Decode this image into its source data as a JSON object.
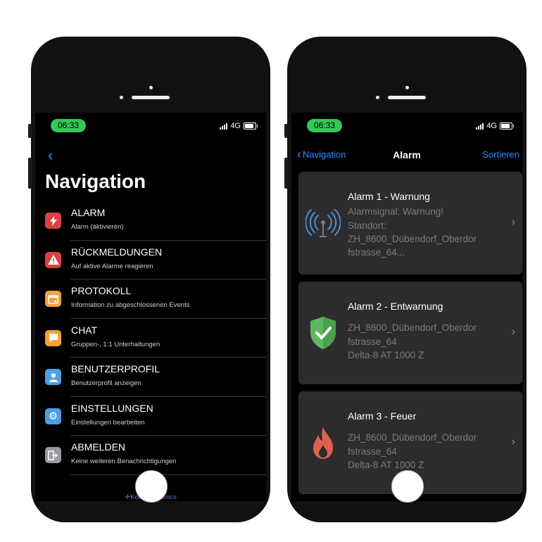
{
  "left_phone": {
    "status": {
      "time": "06:33",
      "network": "4G"
    },
    "back_icon": "chevron-left-icon",
    "title": "Navigation",
    "menu": [
      {
        "label": "ALARM",
        "sub": "Alarm (aktivieren)",
        "icon": "lightning-icon",
        "color": "#d9423e"
      },
      {
        "label": "RÜCKMELDUNGEN",
        "sub": "Auf aktive Alarme reagieren",
        "icon": "warning-icon",
        "color": "#d9423e"
      },
      {
        "label": "PROTOKOLL",
        "sub": "Information zu abgeschlossenen Events",
        "icon": "calendar-icon",
        "color": "#f0a33a"
      },
      {
        "label": "CHAT",
        "sub": "Gruppen-, 1:1 Unterhaltungen",
        "icon": "chat-icon",
        "color": "#f0a33a"
      },
      {
        "label": "BENUTZERPROFIL",
        "sub": "Benutzerprofil anzeigen",
        "icon": "user-icon",
        "color": "#4a9fe3"
      },
      {
        "label": "EINSTELLUNGEN",
        "sub": "Einstellungen bearbeiten",
        "icon": "gear-icon",
        "color": "#4a9fe3"
      },
      {
        "label": "ABMELDEN",
        "sub": "Keine weiteren Benachrichtigungen",
        "icon": "logout-icon",
        "color": "#9a9a9e"
      }
    ],
    "footer": "Kockum Sonics"
  },
  "right_phone": {
    "status": {
      "time": "06:33",
      "network": "4G"
    },
    "nav": {
      "back_label": "Navigation",
      "title": "Alarm",
      "action": "Sortieren"
    },
    "alarms": [
      {
        "title": "Alarm 1 - Warnung",
        "lines": [
          "Alarmsignal: Warnung!",
          "Standort:",
          "ZH_8600_Dübendorf_Oberdor",
          "fstrasse_64..."
        ],
        "icon": "antenna-icon"
      },
      {
        "title": "Alarm 2 - Entwarnung",
        "lines": [
          "ZH_8600_Dübendorf_Oberdor",
          "fstrasse_64",
          "Delta-8 AT 1000 Z"
        ],
        "icon": "shield-check-icon"
      },
      {
        "title": "Alarm 3 - Feuer",
        "lines": [
          "ZH_8600_Dübendorf_Oberdor",
          "fstrasse_64",
          "Delta-8 AT 1000 Z"
        ],
        "icon": "fire-icon"
      }
    ]
  }
}
